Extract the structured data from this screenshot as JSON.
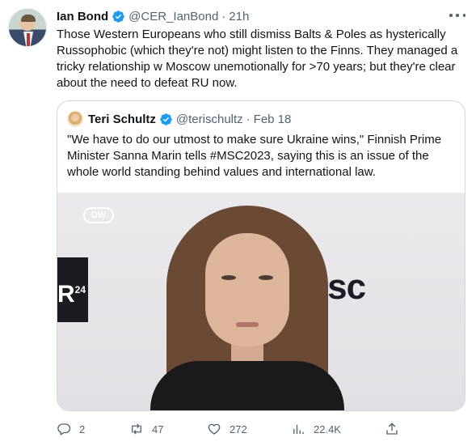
{
  "tweet": {
    "author_name": "Ian Bond",
    "handle": "@CER_IanBond",
    "time": "21h",
    "text": "Those Western Europeans who still dismiss Balts & Poles as hysterically Russophobic (which they're not) might listen to the Finns. They managed a tricky relationship w Moscow unemotionally for >70 years; but they're clear about the need to defeat RU now."
  },
  "quoted": {
    "author_name": "Teri Schultz",
    "handle": "@terischultz",
    "date": "Feb 18",
    "text": "\"We have to do our utmost to make sure Ukraine wins,\" Finnish Prime Minister Sanna Marin tells #MSC2023, saying this is an issue of the whole world standing behind values and international law.",
    "media": {
      "dw_logo": "DW",
      "backdrop_left": "R",
      "backdrop_left_sup": "24",
      "backdrop_right": "msc"
    }
  },
  "actions": {
    "replies": "2",
    "retweets": "47",
    "likes": "272",
    "views": "22.4K"
  },
  "icons": {
    "verified": "verified-badge-icon",
    "more": "more-horizontal-icon",
    "reply": "reply-icon",
    "retweet": "retweet-icon",
    "like": "heart-icon",
    "views": "bar-chart-icon",
    "share": "share-icon"
  },
  "colors": {
    "accent": "#1d9bf0",
    "text": "#0f1419",
    "muted": "#536471",
    "border": "#cfd9de"
  }
}
